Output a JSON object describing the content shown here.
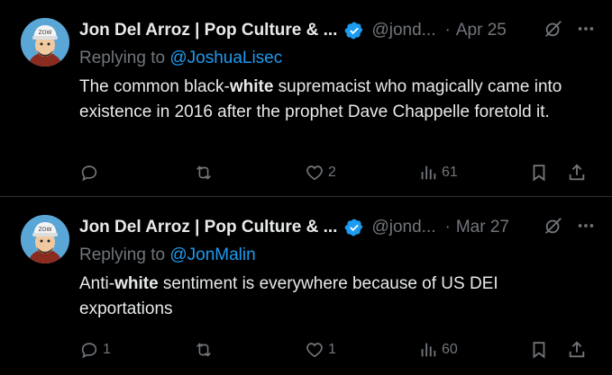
{
  "tweets": [
    {
      "author_name": "Jon Del Arroz | Pop Culture & ...",
      "handle": "@jond...",
      "separator": "·",
      "date": "Apr 25",
      "replying_prefix": "Replying to",
      "replying_to": "@JoshuaLisec",
      "text_before": "The common black-",
      "text_bold": "white",
      "text_after": " supremacist who magically came into existence in 2016 after the prophet Dave Chappelle foretold it.",
      "replies": "",
      "retweets": "",
      "likes": "2",
      "views": "61"
    },
    {
      "author_name": "Jon Del Arroz | Pop Culture & ...",
      "handle": "@jond...",
      "separator": "·",
      "date": "Mar 27",
      "replying_prefix": "Replying to",
      "replying_to": "@JonMalin",
      "text_before": "Anti-",
      "text_bold": "white",
      "text_after": " sentiment is everywhere because of US DEI exportations",
      "replies": "1",
      "retweets": "",
      "likes": "1",
      "views": "60"
    }
  ],
  "colors": {
    "background": "#000000",
    "text": "#e7e9ea",
    "muted": "#71767b",
    "link": "#1d9bf0",
    "verified": "#1d9bf0",
    "divider": "#2f3336"
  },
  "icons": [
    "verified-badge-icon",
    "grok-icon",
    "more-icon",
    "reply-icon",
    "retweet-icon",
    "like-icon",
    "views-icon",
    "bookmark-icon",
    "share-icon"
  ]
}
